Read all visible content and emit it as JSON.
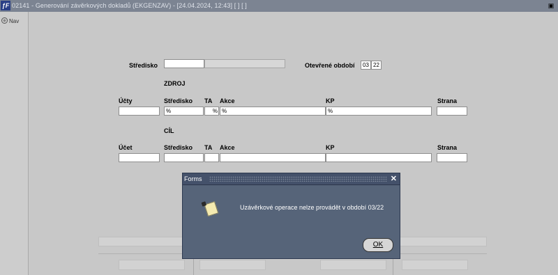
{
  "window": {
    "app_icon": "ƒF",
    "title": "02141 - Generování závěrkových dokladů (EKGENZAV) - [24.04.2024, 12:43]  [ ] [ ]",
    "restore_icon": "restore-icon"
  },
  "nav": {
    "label": "Nav",
    "icon": "navigator-icon"
  },
  "header": {
    "stredisko_label": "Středisko",
    "stredisko_value": "",
    "stredisko_name": "",
    "obdobi_label": "Otevřené období",
    "obdobi_month": "03",
    "obdobi_year": "22"
  },
  "zdroj": {
    "section_label": "ZDROJ",
    "columns": {
      "ucty": "Účty",
      "stredisko": "Středisko",
      "ta": "TA",
      "akce": "Akce",
      "kp": "KP",
      "strana": "Strana"
    },
    "values": {
      "ucty": "",
      "stredisko": "%",
      "ta": "%",
      "akce": "%",
      "kp": "%",
      "strana": ""
    }
  },
  "cil": {
    "section_label": "CÍL",
    "columns": {
      "ucet": "Účet",
      "stredisko": "Středisko",
      "ta": "TA",
      "akce": "Akce",
      "kp": "KP",
      "strana": "Strana"
    },
    "values": {
      "ucet": "",
      "stredisko": "",
      "ta": "",
      "akce": "",
      "kp": "",
      "strana": ""
    }
  },
  "dialog": {
    "title": "Forms",
    "close_icon": "close-icon",
    "message_icon": "note-icon",
    "message": "Uzávěrkové operace nelze provádět v období 03/22",
    "ok_label": "OK"
  }
}
